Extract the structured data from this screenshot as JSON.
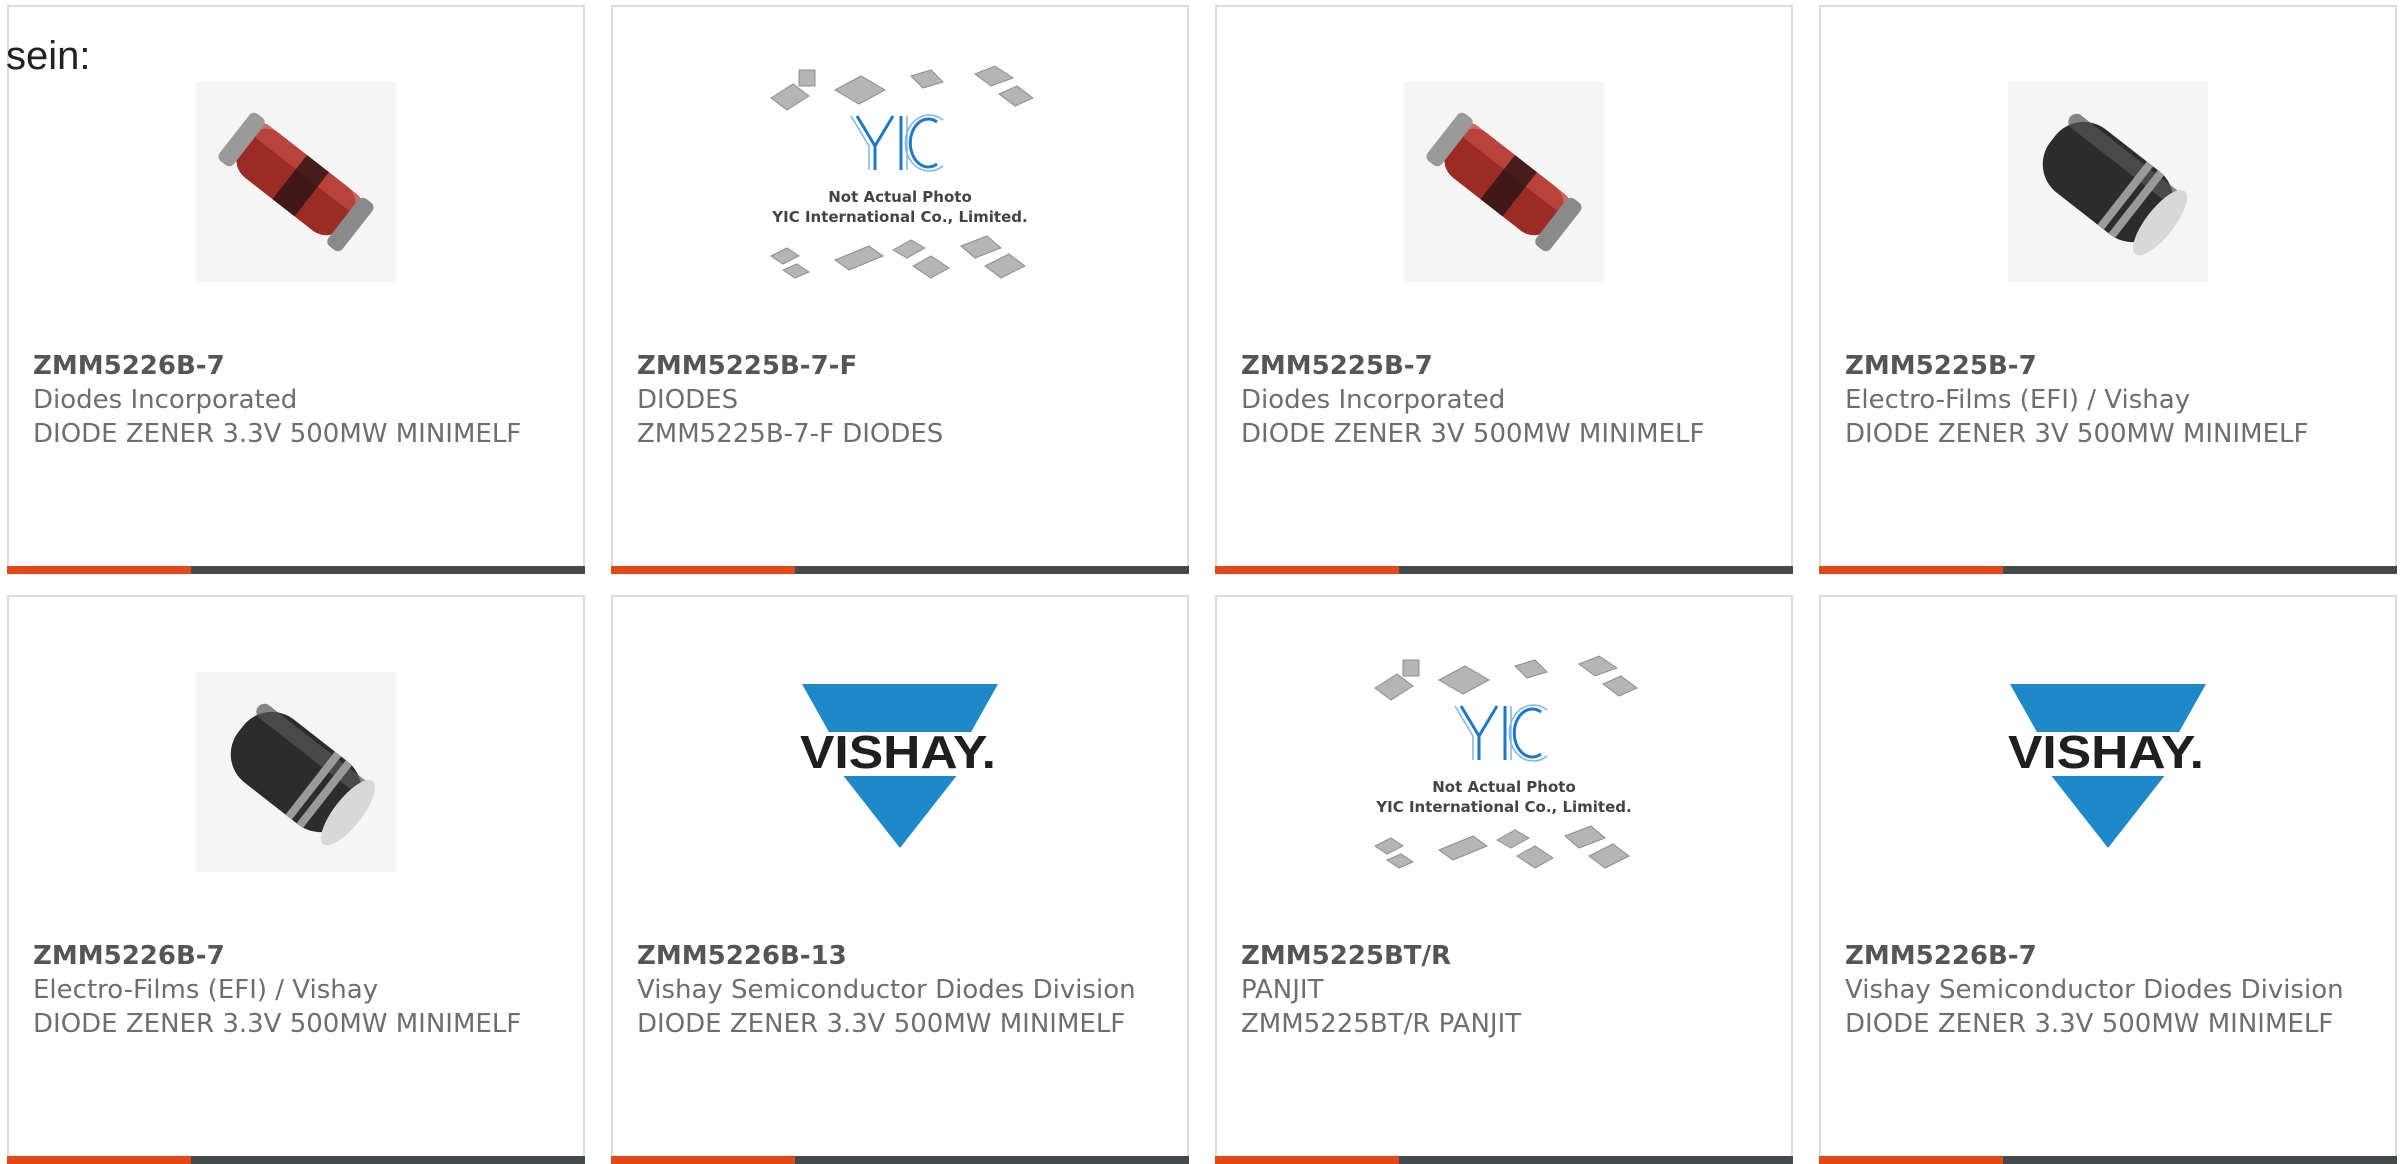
{
  "intro_text": "sein:",
  "products": [
    {
      "part": "ZMM5226B-7",
      "maker": "Diodes Incorporated",
      "desc": "DIODE ZENER 3.3V 500MW MINIMELF",
      "image": "red-diode"
    },
    {
      "part": "ZMM5225B-7-F",
      "maker": "DIODES",
      "desc": "ZMM5225B-7-F DIODES",
      "image": "yic-placeholder"
    },
    {
      "part": "ZMM5225B-7",
      "maker": "Diodes Incorporated",
      "desc": "DIODE ZENER 3V 500MW MINIMELF",
      "image": "red-diode"
    },
    {
      "part": "ZMM5225B-7",
      "maker": "Electro-Films (EFI) / Vishay",
      "desc": "DIODE ZENER 3V 500MW MINIMELF",
      "image": "black-diode"
    },
    {
      "part": "ZMM5226B-7",
      "maker": "Electro-Films (EFI) / Vishay",
      "desc": "DIODE ZENER 3.3V 500MW MINIMELF",
      "image": "black-diode"
    },
    {
      "part": "ZMM5226B-13",
      "maker": "Vishay Semiconductor Diodes Division",
      "desc": "DIODE ZENER 3.3V 500MW MINIMELF",
      "image": "vishay-logo"
    },
    {
      "part": "ZMM5225BT/R",
      "maker": "PANJIT",
      "desc": "ZMM5225BT/R PANJIT",
      "image": "yic-placeholder"
    },
    {
      "part": "ZMM5226B-7",
      "maker": "Vishay Semiconductor Diodes Division",
      "desc": "DIODE ZENER 3.3V 500MW MINIMELF",
      "image": "vishay-logo"
    }
  ],
  "yic": {
    "logo_text": "YIC",
    "caption_line1": "Not Actual Photo",
    "caption_line2": "YIC International Co., Limited."
  },
  "vishay": {
    "logo_text": "VISHAY.",
    "color": "#1e88c8"
  },
  "colors": {
    "accent": "#e14a18",
    "bar": "#444a4c",
    "border": "#dcdcdc"
  }
}
